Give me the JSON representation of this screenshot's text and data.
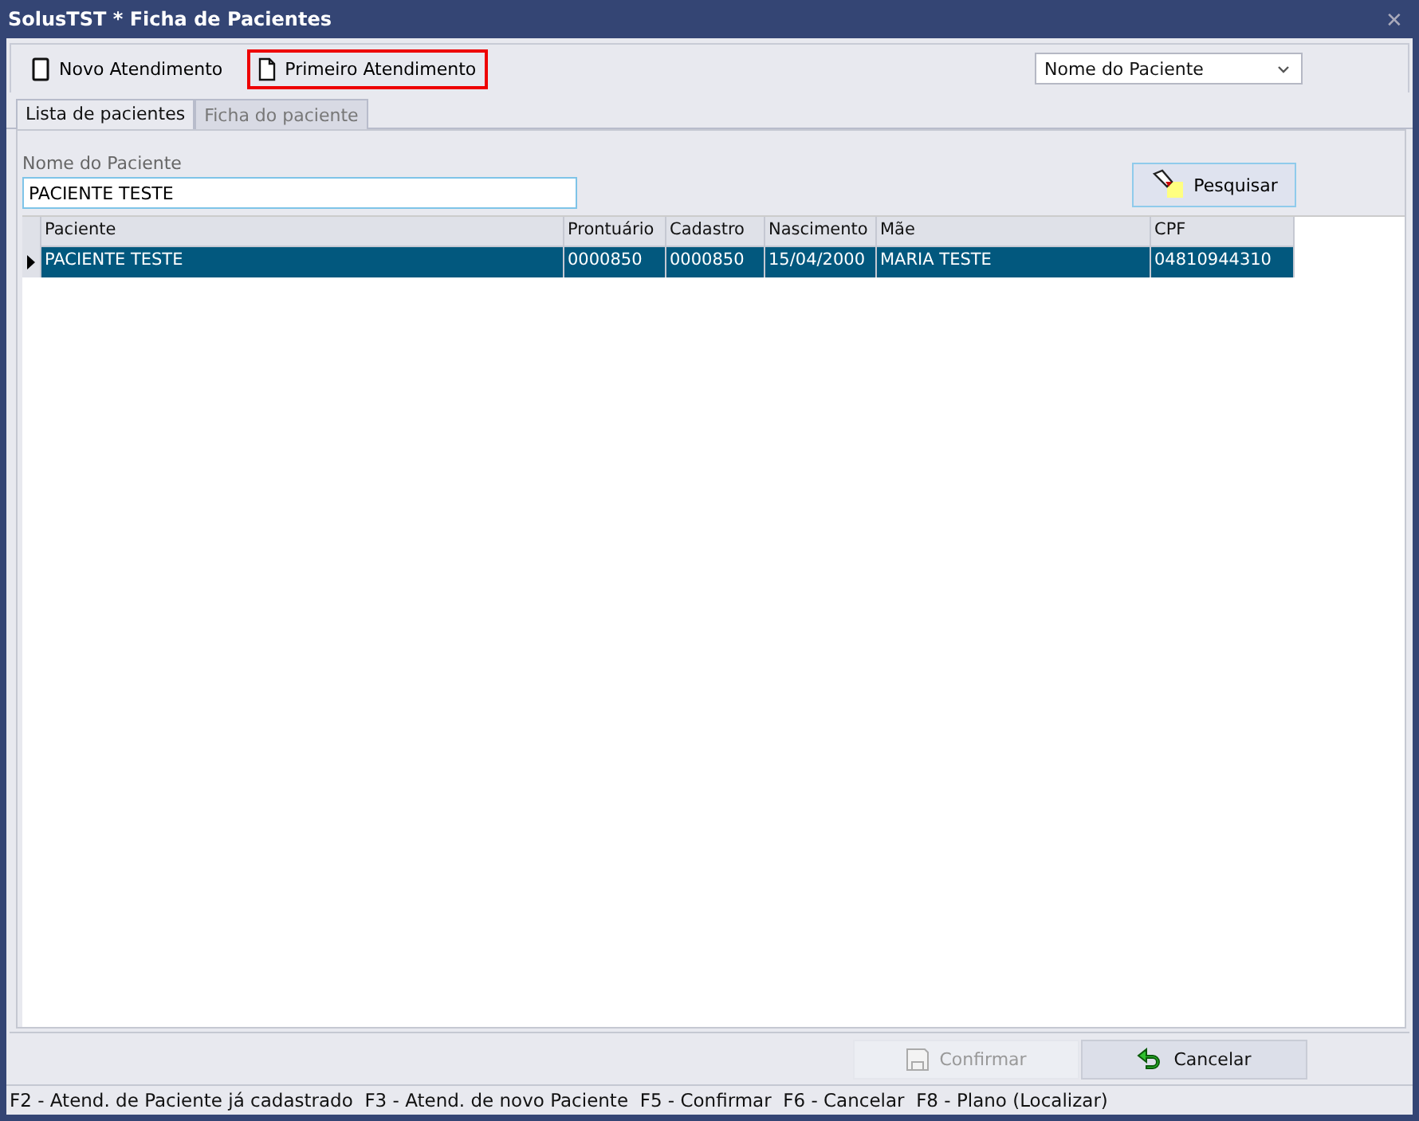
{
  "window": {
    "title": "SolusTST * Ficha de Pacientes",
    "close": "✕"
  },
  "toolbar": {
    "buttons": [
      {
        "label": "Novo Atendimento",
        "kind": "blank",
        "highlighted": false
      },
      {
        "label": "Primeiro Atendimento",
        "kind": "page",
        "highlighted": true
      }
    ],
    "search_by": {
      "value": "Nome do Paciente"
    }
  },
  "tabs": [
    {
      "label": "Lista de pacientes",
      "selected": true
    },
    {
      "label": "Ficha do paciente",
      "selected": false
    }
  ],
  "search": {
    "label": "Nome do Paciente",
    "value": "PACIENTE TESTE",
    "button": "Pesquisar"
  },
  "table": {
    "columns": [
      "Paciente",
      "Prontuário",
      "Cadastro",
      "Nascimento",
      "Mãe",
      "CPF"
    ],
    "rows": [
      {
        "selected": true,
        "cells": [
          "PACIENTE TESTE",
          "0000850",
          "0000850",
          "15/04/2000",
          "MARIA TESTE",
          "04810944310"
        ]
      }
    ]
  },
  "actions": [
    {
      "label": "Confirmar",
      "kind": "save",
      "disabled": true
    },
    {
      "label": "Cancelar",
      "kind": "undo",
      "disabled": false
    }
  ],
  "status_bar": "F2 - Atend. de Paciente já cadastrado  F3 - Atend. de novo Paciente  F5 - Confirmar  F6 - Cancelar  F8 - Plano (Localizar)"
}
